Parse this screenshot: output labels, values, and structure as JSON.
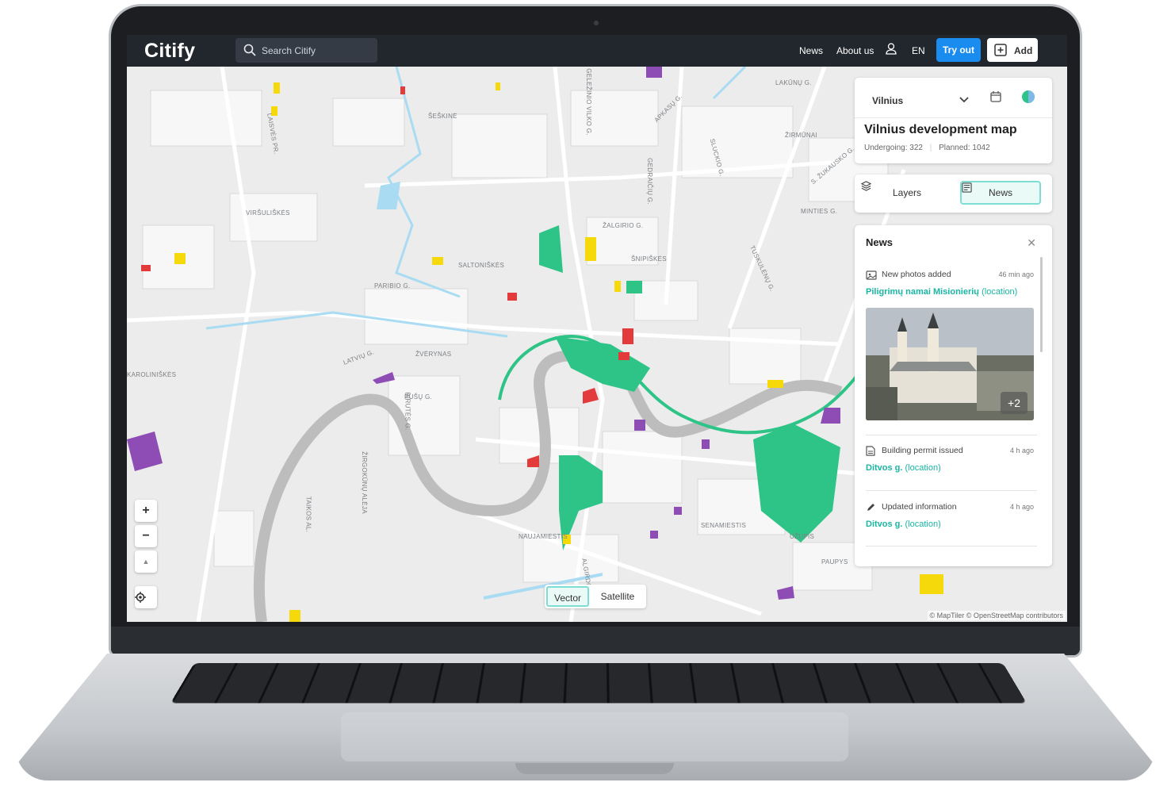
{
  "header": {
    "logo": "Citify",
    "search_placeholder": "Search Citify",
    "nav": [
      "News",
      "About us"
    ],
    "language": "EN",
    "try_out": "Try out",
    "add": "Add"
  },
  "map": {
    "street_labels": [
      "ŠEŠKINĖ",
      "VIRŠULIŠKĖS",
      "SALTONIŠKĖS",
      "ŽALGIRIO G.",
      "ŠNIPIŠKĖS",
      "ŽVĖRYNAS",
      "PARIBIO G.",
      "LAISVĖS PR.",
      "LAKŪNŲ G.",
      "ŽIRMŪNAI",
      "MINTIES G.",
      "TUSKULĖNŲ G.",
      "SENAMIESTIS",
      "UŽUPIS",
      "NAUJAMIESTIS",
      "PAUPYS",
      "ŽIRGOKŪNŲ ALĖJA",
      "TAIKOS AL.",
      "LATVIŲ G.",
      "PUŠŲ G.",
      "BIRUTĖS G.",
      "KAROLINIŠKĖS",
      "GELEŽINIO VILKO G.",
      "ALGIRDO G.",
      "APKASŲ G.",
      "GEDRAIČIŲ G.",
      "S. ŽUKAUSKO G.",
      "SLUCKIO G."
    ],
    "zoom_in": "+",
    "zoom_out": "−",
    "compass": "▲",
    "map_modes": [
      "Vector",
      "Satellite"
    ],
    "active_mode": "Vector",
    "attribution": "© MapTiler © OpenStreetMap contributors",
    "colors": {
      "green": "#2fc487",
      "yellow": "#f5d90a",
      "red": "#e33b3b",
      "purple": "#8d4db5",
      "water": "#a9dcf2",
      "river": "#bdbdbd"
    }
  },
  "city_panel": {
    "city": "Vilnius",
    "title": "Vilnius development map",
    "undergoing": "Undergoing: 322",
    "planned": "Planned: 1042"
  },
  "tabs": {
    "layers": "Layers",
    "news": "News"
  },
  "news_panel": {
    "title": "News",
    "items": [
      {
        "type": "New photos added",
        "time": "46 min ago",
        "place": "Piligrimų namai Misionierių",
        "link": "(location)",
        "icon": "photos-icon",
        "photo_more": "+2"
      },
      {
        "type": "Building permit issued",
        "time": "4 h ago",
        "place": "Ditvos g.",
        "link": "(location)",
        "icon": "document-icon"
      },
      {
        "type": "Updated information",
        "time": "4 h ago",
        "place": "Ditvos g.",
        "link": "(location)",
        "icon": "pencil-icon"
      }
    ]
  }
}
